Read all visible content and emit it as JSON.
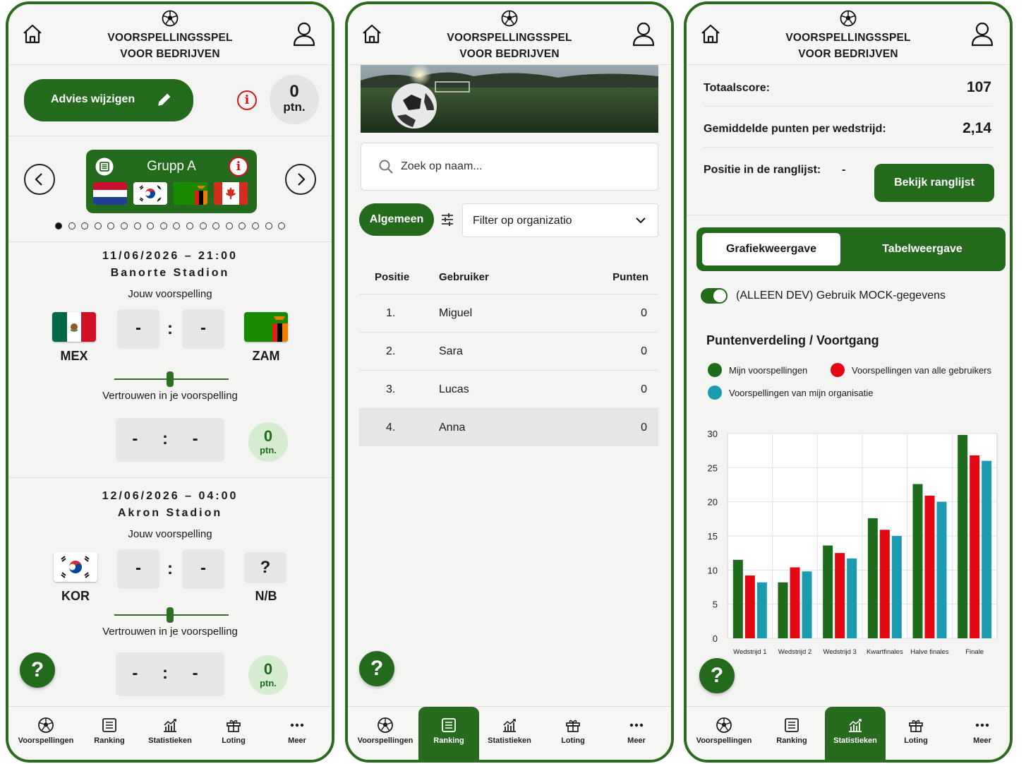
{
  "header": {
    "title_line1": "VOORSPELLINGSSPEL",
    "title_line2": "VOOR BEDRIJVEN"
  },
  "nav": {
    "items": [
      {
        "label": "Voorspellingen",
        "icon": "soccer-ball-icon"
      },
      {
        "label": "Ranking",
        "icon": "list-icon"
      },
      {
        "label": "Statistieken",
        "icon": "chart-icon"
      },
      {
        "label": "Loting",
        "icon": "gift-icon"
      },
      {
        "label": "Meer",
        "icon": "more-icon"
      }
    ]
  },
  "colors": {
    "brand_green": "#246a1d",
    "red": "#e30613",
    "teal": "#1b9bb0",
    "light_green": "#d5ecd0"
  },
  "help_label": "?",
  "predictions": {
    "advice_button": "Advies wijzigen",
    "points": {
      "value": "0",
      "unit": "ptn."
    },
    "group": {
      "name": "Grupp A",
      "flags": [
        "netherlands",
        "south-korea",
        "zambia",
        "canada"
      ]
    },
    "pagination": {
      "total": 18,
      "active": 0
    },
    "matches": [
      {
        "datetime": "11/06/2026 – 21:00",
        "stadium": "Banorte Stadion",
        "your_prediction_label": "Jouw voorspelling",
        "home": {
          "code": "MEX",
          "flag": "mexico"
        },
        "away": {
          "code": "ZAM",
          "flag": "zambia"
        },
        "home_score": "-",
        "away_score": "-",
        "separator": ":",
        "confidence_label": "Vertrouwen in je voorspelling",
        "result": "- : -",
        "points": {
          "value": "0",
          "unit": "ptn."
        }
      },
      {
        "datetime": "12/06/2026 – 04:00",
        "stadium": "Akron Stadion",
        "your_prediction_label": "Jouw voorspelling",
        "home": {
          "code": "KOR",
          "flag": "south-korea"
        },
        "away": {
          "code": "N/B",
          "flag": "unknown",
          "placeholder": "?"
        },
        "home_score": "-",
        "away_score": "-",
        "separator": ":",
        "confidence_label": "Vertrouwen in je voorspelling",
        "result": "- : -",
        "points": {
          "value": "0",
          "unit": "ptn."
        }
      }
    ]
  },
  "ranking": {
    "search_placeholder": "Zoek op naam...",
    "filter_pill": "Algemeen",
    "filter_select": "Filter op organizatio",
    "columns": [
      "Positie",
      "Gebruiker",
      "Punten"
    ],
    "rows": [
      {
        "pos": "1.",
        "name": "Miguel",
        "points": "0"
      },
      {
        "pos": "2.",
        "name": "Sara",
        "points": "0"
      },
      {
        "pos": "3.",
        "name": "Lucas",
        "points": "0"
      },
      {
        "pos": "4.",
        "name": "Anna",
        "points": "0"
      }
    ]
  },
  "stats": {
    "total_label": "Totaalscore:",
    "total_value": "107",
    "avg_label": "Gemiddelde punten per wedstrijd:",
    "avg_value": "2,14",
    "position_label": "Positie in de ranglijst:",
    "position_value": "-",
    "view_ranking_button": "Bekijk ranglijst",
    "tab_chart": "Grafiekweergave",
    "tab_table": "Tabelweergave",
    "mock_toggle_label": "(ALLEEN DEV) Gebruik MOCK-gegevens",
    "chart_title": "Puntenverdeling / Voortgang"
  },
  "chart_data": {
    "type": "bar",
    "title": "Puntenverdeling / Voortgang",
    "categories": [
      "Wedstrijd 1",
      "Wedstrijd 2",
      "Wedstrijd 3",
      "Kwartfinales",
      "Halve finales",
      "Finale"
    ],
    "series": [
      {
        "name": "Mijn voorspellingen",
        "color": "#1f6b1c",
        "values": [
          11.5,
          8.2,
          13.6,
          17.6,
          22.6,
          29.8
        ]
      },
      {
        "name": "Voorspellingen van alle gebruikers",
        "color": "#e30613",
        "values": [
          9.2,
          10.4,
          12.5,
          15.9,
          20.9,
          26.8
        ]
      },
      {
        "name": "Voorspellingen van mijn organisatie",
        "color": "#1b9bb0",
        "values": [
          8.2,
          9.8,
          11.7,
          15.0,
          20.0,
          26.0
        ]
      }
    ],
    "ylim": [
      0,
      30
    ],
    "yticks": [
      0,
      5,
      10,
      15,
      20,
      25,
      30
    ],
    "xlabel": "",
    "ylabel": "",
    "grid": true,
    "legend_position": "top"
  }
}
